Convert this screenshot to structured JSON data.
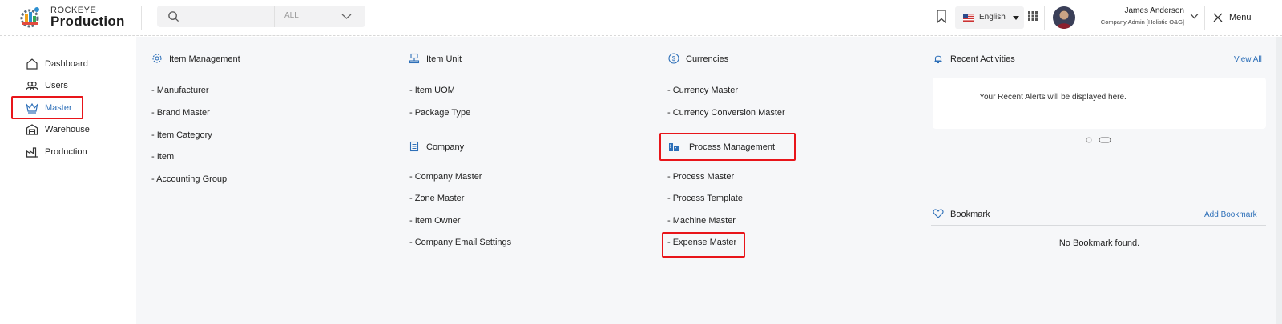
{
  "header": {
    "brand_top": "ROCKEYE",
    "brand_main": "Production",
    "search": {
      "placeholder": "",
      "filter_label": "ALL"
    },
    "language": "English",
    "user": {
      "name": "James Anderson",
      "role": "Company Admin [Holistic O&G]"
    },
    "menu_label": "Menu"
  },
  "sidebar": {
    "items": [
      {
        "label": "Dashboard",
        "icon": "home-icon"
      },
      {
        "label": "Users",
        "icon": "users-icon"
      },
      {
        "label": "Master",
        "icon": "crown-icon",
        "active": true
      },
      {
        "label": "Warehouse",
        "icon": "warehouse-icon"
      },
      {
        "label": "Production",
        "icon": "factory-icon"
      }
    ]
  },
  "sections": {
    "item_management": {
      "title": "Item Management",
      "links": [
        "- Manufacturer",
        "- Brand Master",
        "- Item Category",
        "- Item",
        "- Accounting Group"
      ]
    },
    "item_unit": {
      "title": "Item Unit",
      "links": [
        "- Item UOM",
        "- Package Type"
      ]
    },
    "company": {
      "title": "Company",
      "links": [
        "- Company Master",
        "- Zone Master",
        "- Item Owner",
        "- Company Email Settings"
      ]
    },
    "currencies": {
      "title": "Currencies",
      "links": [
        "- Currency Master",
        "- Currency Conversion Master"
      ]
    },
    "process_management": {
      "title": "Process Management",
      "links": [
        "- Process Master",
        "- Process Template",
        "- Machine Master",
        "- Expense Master"
      ]
    }
  },
  "recent_activities": {
    "title": "Recent Activities",
    "view_all": "View All",
    "empty_text": "Your Recent Alerts will be displayed here."
  },
  "bookmark": {
    "title": "Bookmark",
    "add_label": "Add Bookmark",
    "empty_text": "No Bookmark found."
  },
  "colors": {
    "accent": "#2d6fb8",
    "highlight": "#e8151a",
    "main_bg": "#f6f7f9"
  }
}
